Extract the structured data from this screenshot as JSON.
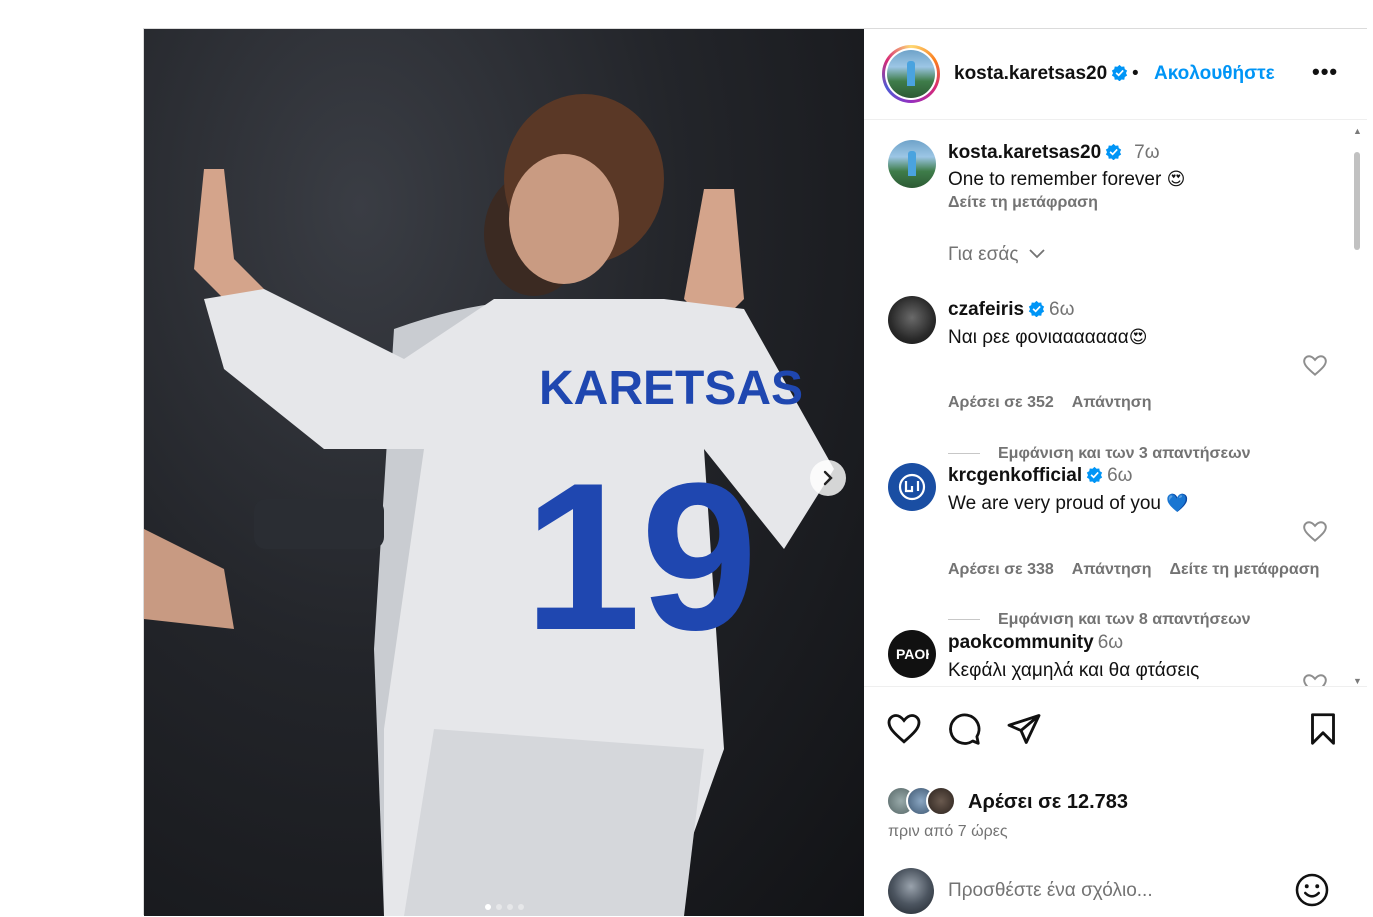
{
  "header": {
    "username": "kosta.karetsas20",
    "separator": "•",
    "follow_label": "Ακολουθήστε",
    "more_label": "•••"
  },
  "caption": {
    "username": "kosta.karetsas20",
    "time": "7ω",
    "text": "One to remember forever",
    "emoji": "😍",
    "translate_label": "Δείτε τη μετάφραση"
  },
  "for_you_label": "Για εσάς",
  "comments": [
    {
      "username": "czafeiris",
      "time": "6ω",
      "text": "Ναι ρεε φονιααααααα",
      "emoji": "😍",
      "likes_label": "Αρέσει σε 352",
      "reply_label": "Απάντηση",
      "replies_label": "Εμφάνιση και των 3 απαντήσεων"
    },
    {
      "username": "krcgenkofficial",
      "time": "6ω",
      "text": "We are very proud of you",
      "emoji": "💙",
      "likes_label": "Αρέσει σε 338",
      "reply_label": "Απάντηση",
      "translate_label": "Δείτε τη μετάφραση",
      "replies_label": "Εμφάνιση και των 8 απαντήσεων"
    },
    {
      "username": "paokcommunity",
      "time": "6ω",
      "text": "Κεφάλι χαμηλά και θα φτάσεις"
    }
  ],
  "image": {
    "jersey_name": "KARETSAS",
    "jersey_number": "19",
    "next_icon": "chevron-right-icon"
  },
  "stats": {
    "likes_label": "Αρέσει σε 12.783",
    "time_ago": "πριν από 7 ώρες"
  },
  "comment_box": {
    "placeholder": "Προσθέστε ένα σχόλιο..."
  },
  "colors": {
    "accent": "#0095f6",
    "verified": "#0095f6",
    "muted": "#737373"
  }
}
